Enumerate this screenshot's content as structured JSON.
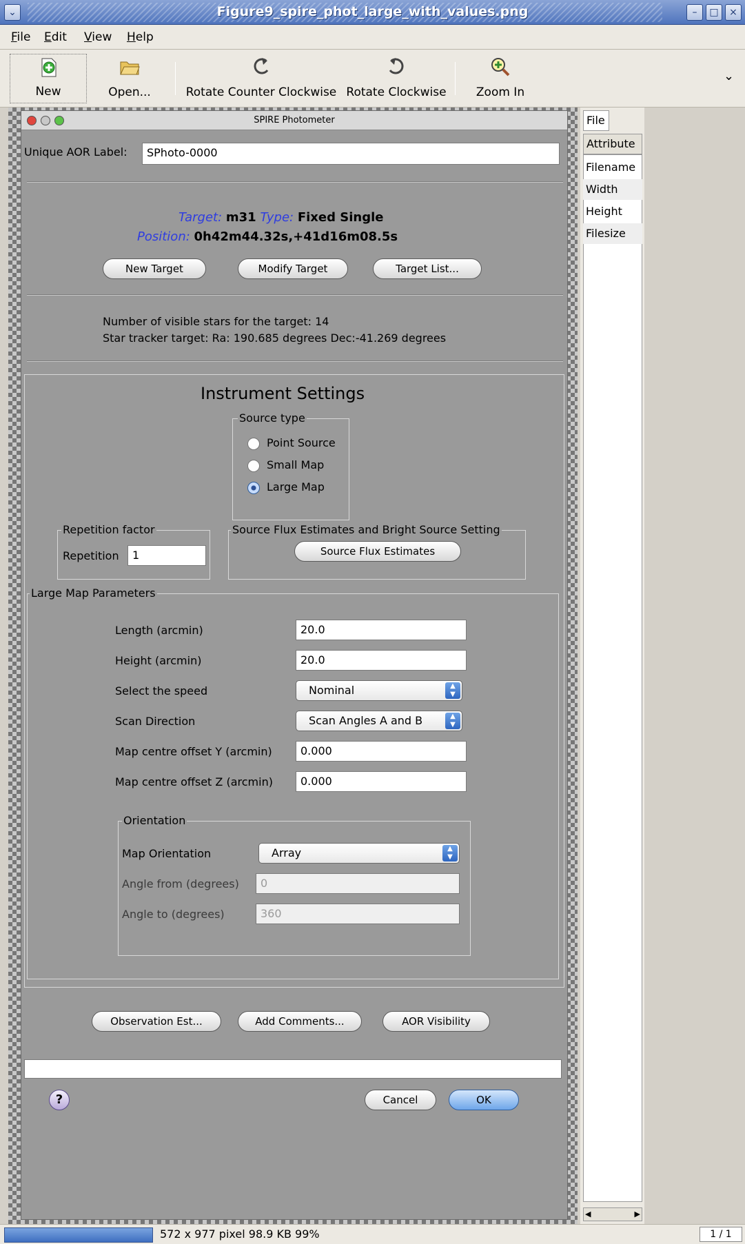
{
  "window": {
    "title": "Figure9_spire_phot_large_with_values.png"
  },
  "menu": [
    "File",
    "Edit",
    "View",
    "Help"
  ],
  "toolbar": {
    "new": "New",
    "open": "Open...",
    "rotate_ccw": "Rotate Counter Clockwise",
    "rotate_cw": "Rotate Clockwise",
    "zoom_in": "Zoom In"
  },
  "dialog": {
    "title": "SPIRE Photometer",
    "aor_label": "Unique AOR Label:",
    "aor_value": "SPhoto-0000",
    "target_label": "Target:",
    "target_value": "m31",
    "type_label": "Type:",
    "type_value": "Fixed Single",
    "position_label": "Position:",
    "position_value": "0h42m44.32s,+41d16m08.5s",
    "buttons": {
      "new_target": "New Target",
      "modify_target": "Modify Target",
      "target_list": "Target List..."
    },
    "visible_stars": "Number of visible stars for the target: 14",
    "star_tracker": "Star tracker target: Ra: 190.685 degrees Dec:-41.269 degrees",
    "instrument_settings": "Instrument Settings",
    "source_type": {
      "title": "Source type",
      "options": [
        "Point Source",
        "Small Map",
        "Large Map"
      ],
      "selected": "Large Map"
    },
    "repetition": {
      "title": "Repetition factor",
      "label": "Repetition",
      "value": "1"
    },
    "flux": {
      "title": "Source Flux Estimates and Bright Source Setting",
      "button": "Source Flux Estimates"
    },
    "large_map": {
      "title": "Large Map Parameters",
      "length_label": "Length (arcmin)",
      "length_value": "20.0",
      "height_label": "Height (arcmin)",
      "height_value": "20.0",
      "speed_label": "Select the speed",
      "speed_value": "Nominal",
      "scan_label": "Scan Direction",
      "scan_value": "Scan Angles A and B",
      "offset_y_label": "Map centre offset Y (arcmin)",
      "offset_y_value": "0.000",
      "offset_z_label": "Map centre offset Z (arcmin)",
      "offset_z_value": "0.000"
    },
    "orientation": {
      "title": "Orientation",
      "map_label": "Map Orientation",
      "map_value": "Array",
      "from_label": "Angle from (degrees)",
      "from_value": "0",
      "to_label": "Angle to (degrees)",
      "to_value": "360"
    },
    "footer": {
      "obs_est": "Observation Est...",
      "comments": "Add Comments...",
      "visibility": "AOR Visibility",
      "cancel": "Cancel",
      "ok": "OK"
    }
  },
  "side_panel": {
    "tab": "File",
    "header": "Attribute",
    "rows": [
      "Filename",
      "Width",
      "Height",
      "Filesize"
    ]
  },
  "status": {
    "info": "572 x 977 pixel  98.9 KB     99%",
    "page": "1 / 1"
  },
  "colors": {
    "title_bar": "#4f74bd",
    "dialog_bg": "#9a9a9a",
    "blue_label": "#2f3de0",
    "ok_button": "#6ea6ea"
  }
}
